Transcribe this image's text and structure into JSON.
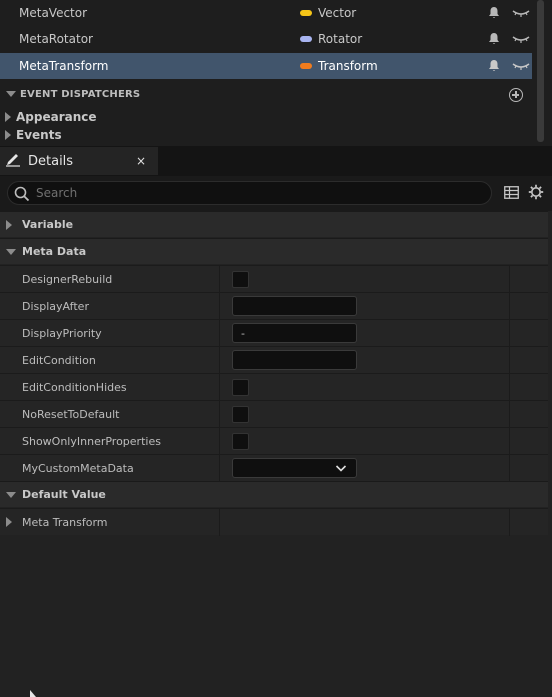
{
  "variables": [
    {
      "name": "MetaVector",
      "type": "Vector",
      "color": "#f5c518"
    },
    {
      "name": "MetaRotator",
      "type": "Rotator",
      "color": "#a8b4f0"
    },
    {
      "name": "MetaTransform",
      "type": "Transform",
      "color": "#f07c1e"
    }
  ],
  "event_dispatchers": {
    "label": "EVENT DISPATCHERS"
  },
  "categories": [
    "Appearance",
    "Events"
  ],
  "details_tab": {
    "label": "Details",
    "close": "×"
  },
  "search": {
    "placeholder": "Search"
  },
  "sections": {
    "variable": "Variable",
    "meta_data": "Meta Data",
    "default_value": "Default Value"
  },
  "meta_props": [
    {
      "name": "DesignerRebuild",
      "kind": "checkbox"
    },
    {
      "name": "DisplayAfter",
      "kind": "text",
      "value": ""
    },
    {
      "name": "DisplayPriority",
      "kind": "text",
      "value": "-"
    },
    {
      "name": "EditCondition",
      "kind": "text",
      "value": ""
    },
    {
      "name": "EditConditionHides",
      "kind": "checkbox"
    },
    {
      "name": "NoResetToDefault",
      "kind": "checkbox"
    },
    {
      "name": "ShowOnlyInnerProperties",
      "kind": "checkbox"
    },
    {
      "name": "MyCustomMetaData",
      "kind": "dropdown",
      "value": ""
    }
  ],
  "default_props": [
    {
      "name": "Meta Transform"
    }
  ]
}
